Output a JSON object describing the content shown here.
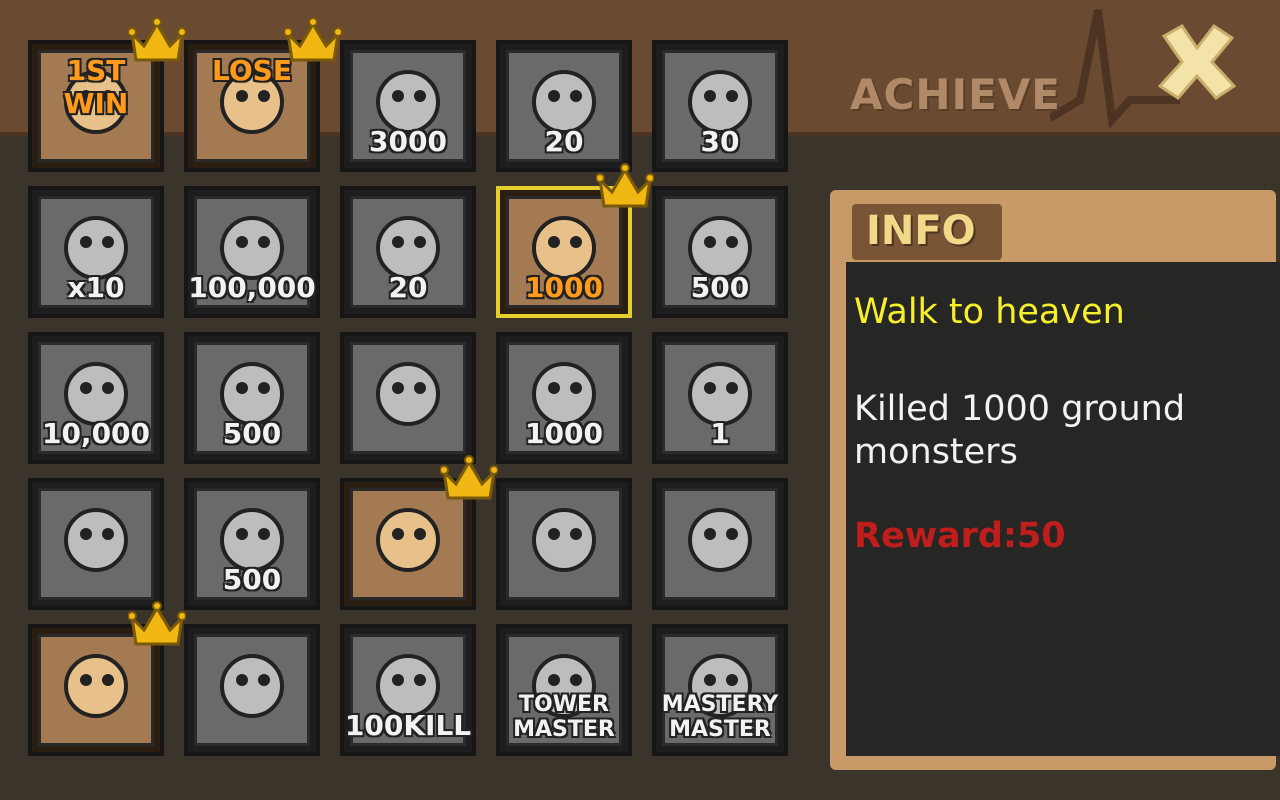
{
  "header": {
    "title": "ACHIEVE",
    "close_icon": "close-x-icon"
  },
  "achievements": [
    {
      "id": "first-win",
      "label": "1ST WIN",
      "icon": "red-hat-hero-icon",
      "completed": true,
      "crown": true
    },
    {
      "id": "lose",
      "label": "LOSE",
      "icon": "broken-shield-icon",
      "completed": true,
      "crown": true
    },
    {
      "id": "coins-3000",
      "label": "3000",
      "icon": "coin-pile-icon",
      "completed": false,
      "crown": false
    },
    {
      "id": "tower-20",
      "label": "20",
      "icon": "tower-20-icon",
      "completed": false,
      "crown": false
    },
    {
      "id": "upgrade-30",
      "label": "30",
      "icon": "upgrade-arrow-icon",
      "completed": false,
      "crown": false
    },
    {
      "id": "miss-10",
      "label": "x10",
      "icon": "miss-monster-icon",
      "completed": false,
      "crown": false
    },
    {
      "id": "money-100000",
      "label": "100,000",
      "icon": "money-bag-icon",
      "completed": false,
      "crown": false
    },
    {
      "id": "kill-20",
      "label": "20",
      "icon": "knight-helmet-icon",
      "completed": false,
      "crown": false
    },
    {
      "id": "ground-1000",
      "label": "1000",
      "icon": "footprints-icon",
      "completed": true,
      "crown": true,
      "selected": true
    },
    {
      "id": "fly-500",
      "label": "500",
      "icon": "bat-icon",
      "completed": false,
      "crown": false
    },
    {
      "id": "axe-10000",
      "label": "10,000",
      "icon": "axe-icon",
      "completed": false,
      "crown": false
    },
    {
      "id": "tower-500",
      "label": "500",
      "icon": "tower-500-icon",
      "completed": false,
      "crown": false
    },
    {
      "id": "winged-blast",
      "label": "",
      "icon": "winged-explosion-icon",
      "completed": false,
      "crown": false
    },
    {
      "id": "arrow-1000",
      "label": "1000",
      "icon": "arrow-1000-icon",
      "completed": false,
      "crown": false
    },
    {
      "id": "heart-1",
      "label": "1",
      "icon": "heart-icon",
      "completed": false,
      "crown": false
    },
    {
      "id": "boss-ring",
      "label": "",
      "icon": "boss-ring-icon",
      "completed": false,
      "crown": false
    },
    {
      "id": "rocks-500",
      "label": "500",
      "icon": "rock-pile-icon",
      "completed": false,
      "crown": false
    },
    {
      "id": "nuke",
      "label": "",
      "icon": "mushroom-cloud-icon",
      "completed": true,
      "crown": true
    },
    {
      "id": "stone-golem",
      "label": "",
      "icon": "stone-golem-icon",
      "completed": false,
      "crown": false
    },
    {
      "id": "slash",
      "label": "",
      "icon": "blade-slash-icon",
      "completed": false,
      "crown": false
    },
    {
      "id": "bomb",
      "label": "",
      "icon": "skull-bomb-icon",
      "completed": true,
      "crown": true
    },
    {
      "id": "viking",
      "label": "",
      "icon": "viking-helmet-icon",
      "completed": false,
      "crown": false
    },
    {
      "id": "kill-100",
      "label": "100KILL",
      "icon": "bunny-icon",
      "completed": false,
      "crown": false
    },
    {
      "id": "tower-master",
      "label": "TOWER MASTER",
      "icon": "star-wings-icon",
      "completed": false,
      "crown": false
    },
    {
      "id": "mastery-master",
      "label": "MASTERY MASTER",
      "icon": "m-wings-icon",
      "completed": false,
      "crown": false
    }
  ],
  "info": {
    "tab_label": "INFO",
    "title": "Walk to heaven",
    "description": "Killed 1000 ground monsters",
    "reward": "Reward:50"
  },
  "colors": {
    "selected_border": "#e6cf2a",
    "info_title": "#f6f02a",
    "reward": "#c01d1d",
    "crown": "#f1b814"
  }
}
